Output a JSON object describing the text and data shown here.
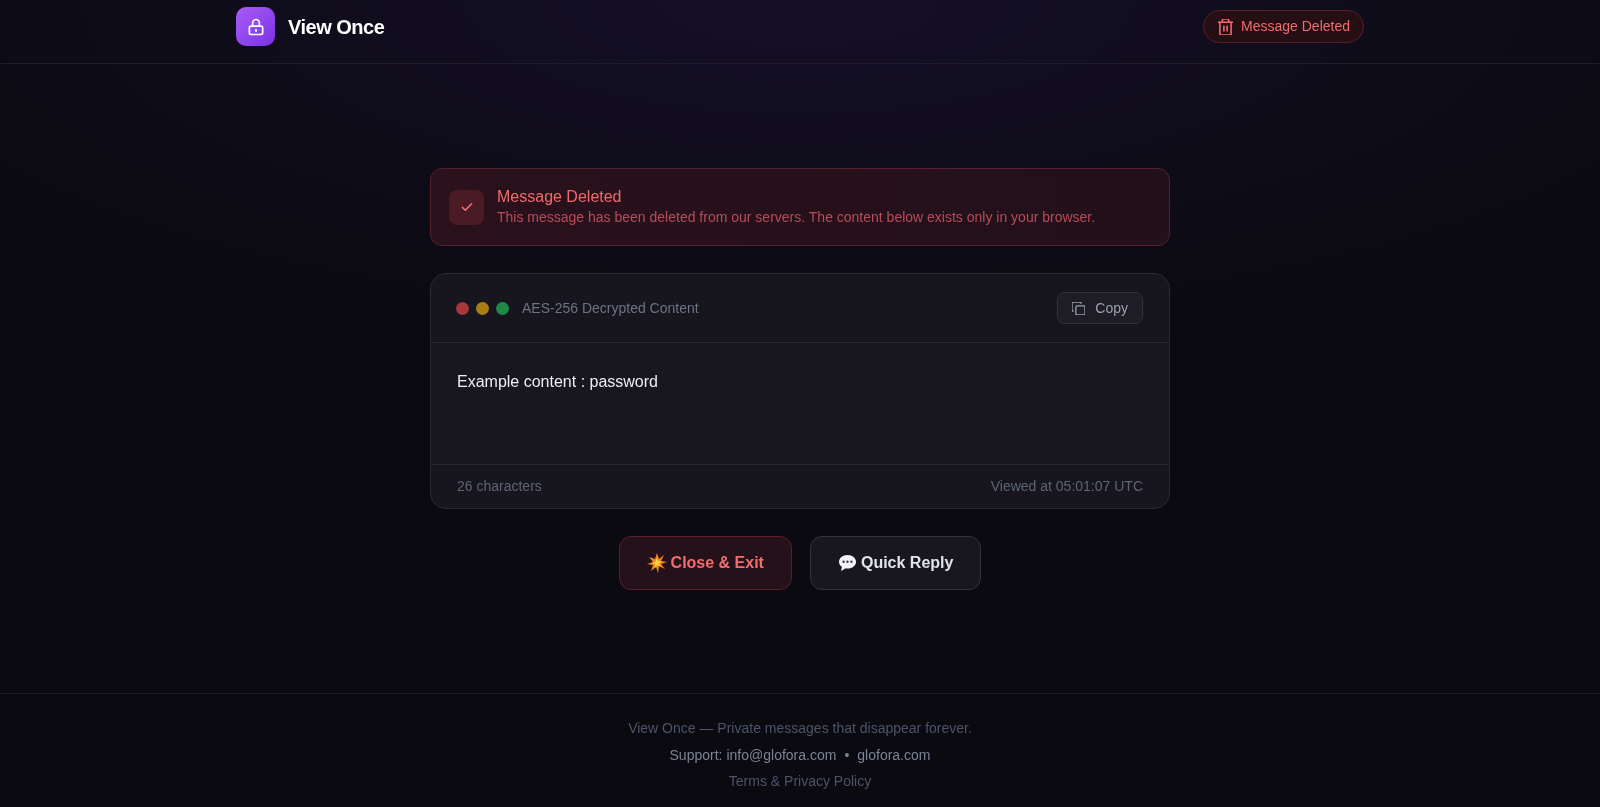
{
  "header": {
    "title": "View Once",
    "status_badge": {
      "label": "Message Deleted"
    }
  },
  "alert": {
    "title": "Message Deleted",
    "text": "This message has been deleted from our servers. The content below exists only in your browser."
  },
  "content_card": {
    "window_dots": [
      {
        "color": "#a8363b"
      },
      {
        "color": "#a87d14"
      },
      {
        "color": "#1d8a47"
      }
    ],
    "label": "AES-256 Decrypted Content",
    "copy_button": "Copy",
    "content": "Example content : password",
    "char_count": "26 characters",
    "viewed_at": "Viewed at 05:01:07 UTC"
  },
  "actions": [
    {
      "kind": "danger",
      "label": "Close & Exit"
    },
    {
      "kind": "secondary",
      "label": "Quick Reply"
    }
  ],
  "footer": {
    "tagline": "View Once — Private messages that disappear forever.",
    "support_label": "Support:",
    "email": "info@glofora.com",
    "separator": "•",
    "site": "glofora.com",
    "terms": "Terms & Privacy Policy"
  }
}
